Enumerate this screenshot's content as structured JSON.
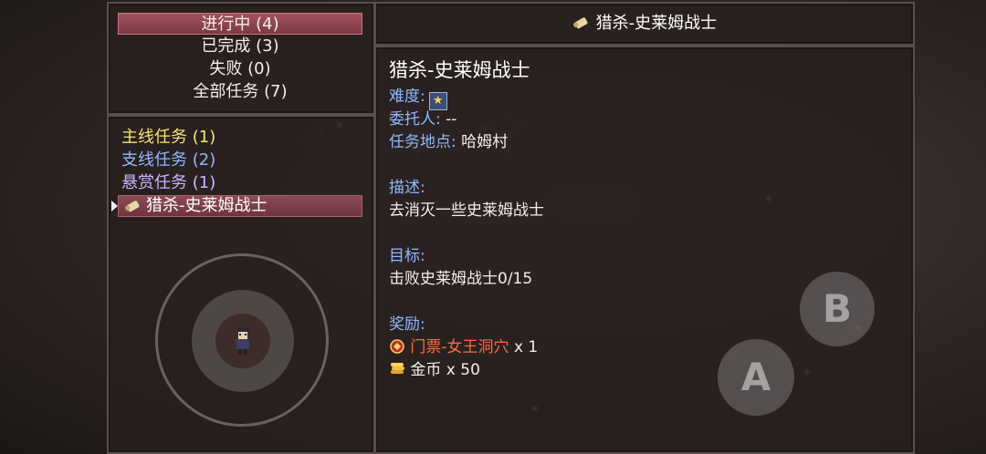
{
  "tabs": [
    {
      "label": "进行中 (4)",
      "active": true
    },
    {
      "label": "已完成 (3)",
      "active": false
    },
    {
      "label": "失败 (0)",
      "active": false
    },
    {
      "label": "全部任务 (7)",
      "active": false
    }
  ],
  "categories": {
    "main": "主线任务 (1)",
    "side": "支线任务 (2)",
    "bounty": "悬赏任务 (1)"
  },
  "quest_list": {
    "selected_item": "猎杀-史莱姆战士"
  },
  "title_bar": {
    "title": "猎杀-史莱姆战士"
  },
  "detail": {
    "name": "猎杀-史莱姆战士",
    "difficulty_label": "难度:",
    "difficulty_stars": 1,
    "client_label": "委托人:",
    "client_value": "--",
    "location_label": "任务地点:",
    "location_value": "哈姆村",
    "desc_label": "描述:",
    "desc_value": "去消灭一些史莱姆战士",
    "goal_label": "目标:",
    "goal_value": "击败史莱姆战士0/15",
    "reward_label": "奖励:",
    "rewards": [
      {
        "name": "门票-女王洞穴",
        "qty": " x 1",
        "icon": "ticket-icon"
      },
      {
        "name": "金币",
        "qty": " x 50",
        "icon": "gold-coins-icon"
      }
    ]
  },
  "controls": {
    "b_label": "B",
    "a_label": "A"
  },
  "colors": {
    "active_tab": "#a2515d",
    "label_blue": "#8fb8ff",
    "main_quest": "#f5e27a",
    "ticket": "#ff6a3a"
  }
}
